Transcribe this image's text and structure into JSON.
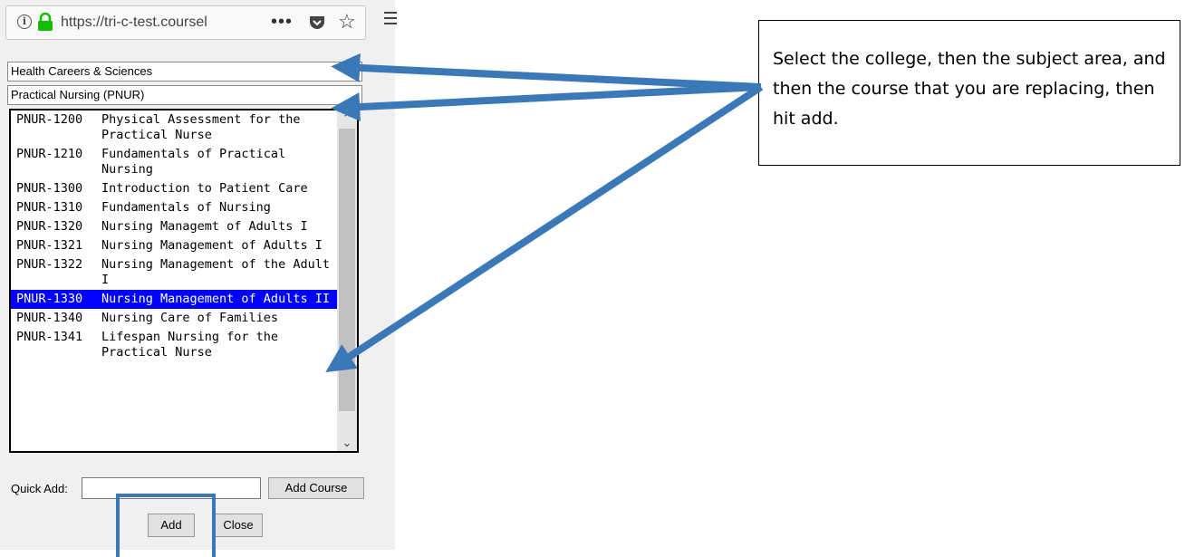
{
  "browser": {
    "url": "https://tri-c-test.coursel",
    "info_icon": "info-icon",
    "lock_icon": "lock-icon",
    "more_icon": "ellipsis-icon",
    "pocket_icon": "pocket-icon",
    "bookmark_icon": "star-icon",
    "menu_icon": "hamburger-menu-icon"
  },
  "form": {
    "college_select": "Health Careers & Sciences",
    "subject_select": "Practical Nursing (PNUR)",
    "courses": [
      {
        "code": "PNUR-1200",
        "title": "Physical Assessment for the Practical Nurse",
        "selected": false
      },
      {
        "code": "PNUR-1210",
        "title": "Fundamentals of Practical Nursing",
        "selected": false
      },
      {
        "code": "PNUR-1300",
        "title": "Introduction to Patient Care",
        "selected": false
      },
      {
        "code": "PNUR-1310",
        "title": "Fundamentals of Nursing",
        "selected": false
      },
      {
        "code": "PNUR-1320",
        "title": "Nursing Managemt of Adults I",
        "selected": false
      },
      {
        "code": "PNUR-1321",
        "title": "Nursing Management of Adults I",
        "selected": false
      },
      {
        "code": "PNUR-1322",
        "title": "Nursing Management of the Adult I",
        "selected": false
      },
      {
        "code": "PNUR-1330",
        "title": "Nursing Management of Adults II",
        "selected": true
      },
      {
        "code": "PNUR-1340",
        "title": "Nursing Care of Families",
        "selected": false
      },
      {
        "code": "PNUR-1341",
        "title": "Lifespan Nursing for the Practical Nurse",
        "selected": false
      }
    ],
    "quick_add_label": "Quick Add:",
    "quick_add_value": "",
    "add_course_button": "Add Course",
    "add_button": "Add",
    "close_button": "Close"
  },
  "callout": {
    "text": "Select the college, then the subject area, and then the course that you are replacing, then hit add."
  },
  "colors": {
    "selected_row": "#0000ff",
    "arrow": "#3a78b8"
  }
}
